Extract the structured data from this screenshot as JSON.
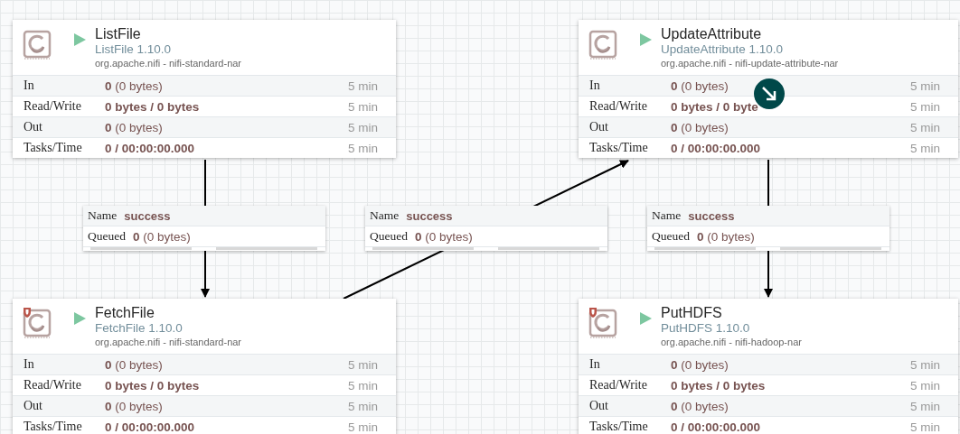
{
  "processors": [
    {
      "name": "ListFile",
      "type": "ListFile 1.10.0",
      "bundle": "org.apache.nifi - nifi-standard-nar",
      "running": true,
      "restricted": false,
      "stats": [
        {
          "label": "In",
          "strong": "0",
          "rest": "(0 bytes)",
          "window": "5 min"
        },
        {
          "label": "Read/Write",
          "strong": "0 bytes / 0 bytes",
          "window": "5 min"
        },
        {
          "label": "Out",
          "strong": "0",
          "rest": "(0 bytes)",
          "window": "5 min"
        },
        {
          "label": "Tasks/Time",
          "strong": "0 / 00:00:00.000",
          "window": "5 min"
        }
      ]
    },
    {
      "name": "UpdateAttribute",
      "type": "UpdateAttribute 1.10.0",
      "bundle": "org.apache.nifi - nifi-update-attribute-nar",
      "running": true,
      "restricted": false,
      "stats": [
        {
          "label": "In",
          "strong": "0",
          "rest": "(0 bytes)",
          "window": "5 min"
        },
        {
          "label": "Read/Write",
          "strong": "0 bytes / 0 byte",
          "window": "5 min"
        },
        {
          "label": "Out",
          "strong": "0",
          "rest": "(0 bytes)",
          "window": "5 min"
        },
        {
          "label": "Tasks/Time",
          "strong": "0 / 00:00:00.000",
          "window": "5 min"
        }
      ]
    },
    {
      "name": "FetchFile",
      "type": "FetchFile 1.10.0",
      "bundle": "org.apache.nifi - nifi-standard-nar",
      "running": true,
      "restricted": true,
      "stats": [
        {
          "label": "In",
          "strong": "0",
          "rest": "(0 bytes)",
          "window": "5 min"
        },
        {
          "label": "Read/Write",
          "strong": "0 bytes / 0 bytes",
          "window": "5 min"
        },
        {
          "label": "Out",
          "strong": "0",
          "rest": "(0 bytes)",
          "window": "5 min"
        },
        {
          "label": "Tasks/Time",
          "strong": "0 / 00:00:00.000",
          "window": "5 min"
        }
      ]
    },
    {
      "name": "PutHDFS",
      "type": "PutHDFS 1.10.0",
      "bundle": "org.apache.nifi - nifi-hadoop-nar",
      "running": true,
      "restricted": true,
      "stats": [
        {
          "label": "In",
          "strong": "0",
          "rest": "(0 bytes)",
          "window": "5 min"
        },
        {
          "label": "Read/Write",
          "strong": "0 bytes / 0 bytes",
          "window": "5 min"
        },
        {
          "label": "Out",
          "strong": "0",
          "rest": "(0 bytes)",
          "window": "5 min"
        },
        {
          "label": "Tasks/Time",
          "strong": "0 / 00:00:00.000",
          "window": "5 min"
        }
      ]
    }
  ],
  "connections": [
    {
      "name_label": "Name",
      "name": "success",
      "queued_label": "Queued",
      "count": "0",
      "size": "(0 bytes)",
      "bars": [
        {
          "level": 0
        },
        {
          "level": 0
        }
      ]
    },
    {
      "name_label": "Name",
      "name": "success",
      "queued_label": "Queued",
      "count": "0",
      "size": "(0 bytes)",
      "bars": [
        {
          "level": 0
        },
        {
          "level": 0
        }
      ]
    },
    {
      "name_label": "Name",
      "name": "success",
      "queued_label": "Queued",
      "count": "0",
      "size": "(0 bytes)",
      "bars": [
        {
          "level": 0
        },
        {
          "level": 0
        }
      ]
    }
  ]
}
